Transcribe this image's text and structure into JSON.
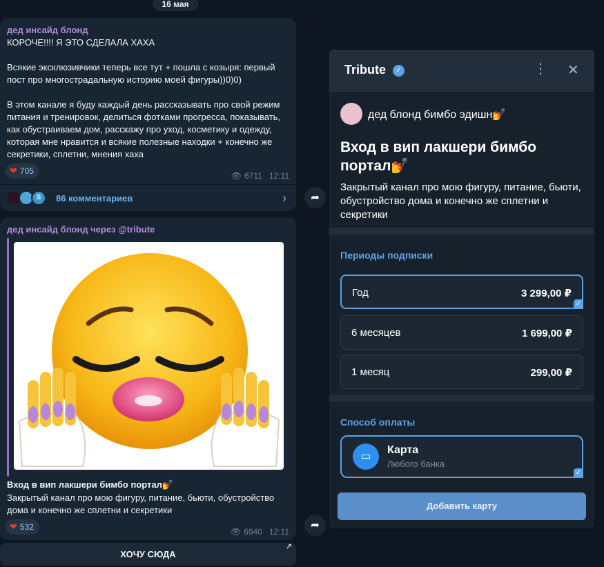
{
  "date_label": "16 мая",
  "messages": [
    {
      "author": "дед инсайд блонд",
      "text": "КОРОЧЕ!!!! Я ЭТО СДЕЛАЛА ХАХА\n\nВсякие эксклюзивчики теперь все тут + пошла с козыря: первый пост про многострадальную историю моей фигуры))0)0)\n\nВ этом канале я буду каждый день рассказывать про свой режим питания и тренировок, делиться фотками прогресса, показывать, как обустраиваем дом, расскажу про уход, косметику и одежду, которая мне нравится и всякие полезные находки + конечно же секретики, сплетни, мнения хаха",
      "reactions": "705",
      "views": "6711",
      "time": "12:11",
      "comments": "86 комментариев",
      "avatar_letter": "S"
    },
    {
      "author": "дед инсайд блонд через @tribute",
      "title": "Вход в вип лакшери бимбо портал💅",
      "body": "Закрытый канал про мою фигуру, питание, бьюти, обустройство дома и конечно же сплетни и секретики",
      "reactions": "532",
      "views": "6940",
      "time": "12:11",
      "button": "ХОЧУ СЮДА"
    }
  ],
  "panel": {
    "title": "Tribute",
    "channel_name": "дед блонд бимбо эдишн💅",
    "heading": "Вход в вип лакшери бимбо портал💅",
    "description": "Закрытый канал про мою фигуру, питание, бьюти, обустройство дома и конечно же сплетни и секретики",
    "periods_title": "Периоды подписки",
    "periods": [
      {
        "label": "Год",
        "price": "3 299,00 ₽"
      },
      {
        "label": "6 месяцев",
        "price": "1 699,00 ₽"
      },
      {
        "label": "1 месяц",
        "price": "299,00 ₽"
      }
    ],
    "payment_title": "Способ оплаты",
    "payment": {
      "title": "Карта",
      "subtitle": "Любого банка"
    },
    "add_card": "Добавить карту"
  },
  "colors": {
    "accent": "#5ca3e6",
    "author": "#b48ad8",
    "heart": "#e53935"
  }
}
